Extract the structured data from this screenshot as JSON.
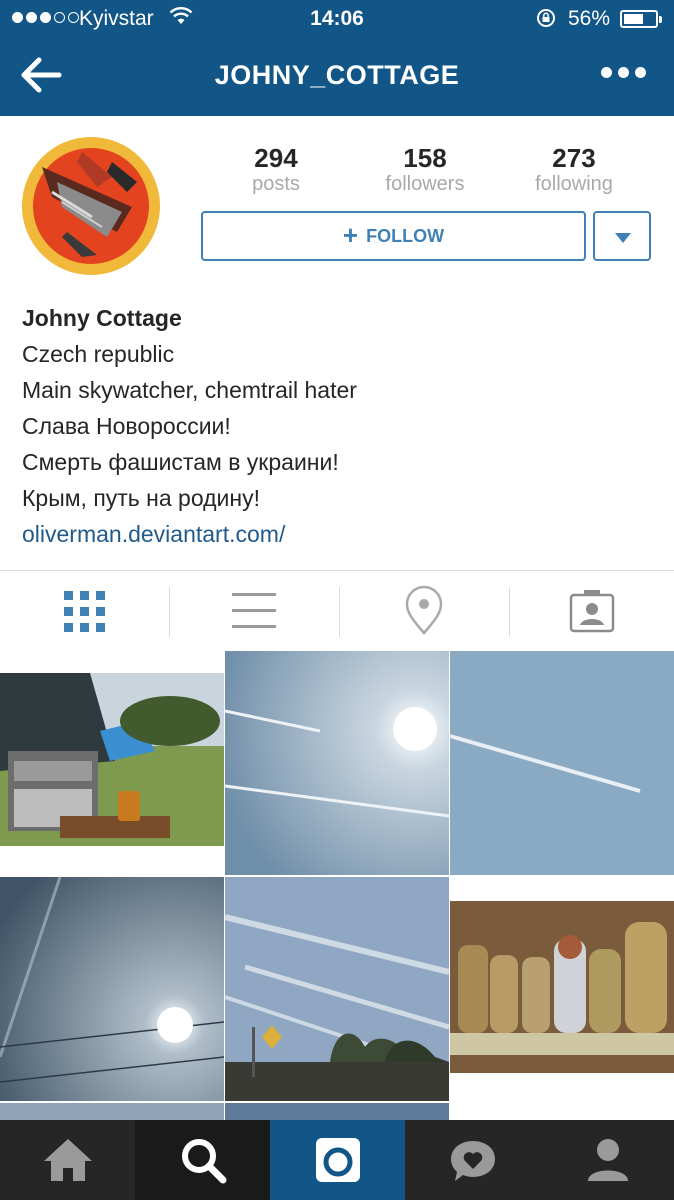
{
  "status_bar": {
    "carrier": "Kyivstar",
    "time": "14:06",
    "battery_percent": "56%",
    "battery_level": 0.56,
    "signal_bars_filled": 3,
    "signal_bars_total": 5
  },
  "nav": {
    "title": "JOHNY_COTTAGE",
    "back_icon": "back-arrow-icon",
    "more_icon": "more-dots-icon"
  },
  "profile": {
    "stats": [
      {
        "value": "294",
        "label": "posts"
      },
      {
        "value": "158",
        "label": "followers"
      },
      {
        "value": "273",
        "label": "following"
      }
    ],
    "follow_label": "FOLLOW",
    "bio": {
      "name": "Johny Cottage",
      "lines": [
        "Czech republic",
        "Main skywatcher, chemtrail hater",
        "Слава Новороссии!",
        "Смерть фашистам в украини!",
        "Крым, путь на родину!"
      ],
      "link": "oliverman.deviantart.com/"
    }
  },
  "tabs": [
    {
      "icon": "grid-view-icon",
      "active": true
    },
    {
      "icon": "list-view-icon",
      "active": false
    },
    {
      "icon": "map-pin-icon",
      "active": false
    },
    {
      "icon": "tagged-photos-icon",
      "active": false
    }
  ],
  "bottom_nav": [
    {
      "icon": "home-icon"
    },
    {
      "icon": "search-icon",
      "active": true
    },
    {
      "icon": "camera-icon"
    },
    {
      "icon": "activity-heart-icon"
    },
    {
      "icon": "profile-icon"
    }
  ],
  "colors": {
    "brand": "#125688",
    "accent": "#3f81b6",
    "link": "#1f5a8a"
  }
}
